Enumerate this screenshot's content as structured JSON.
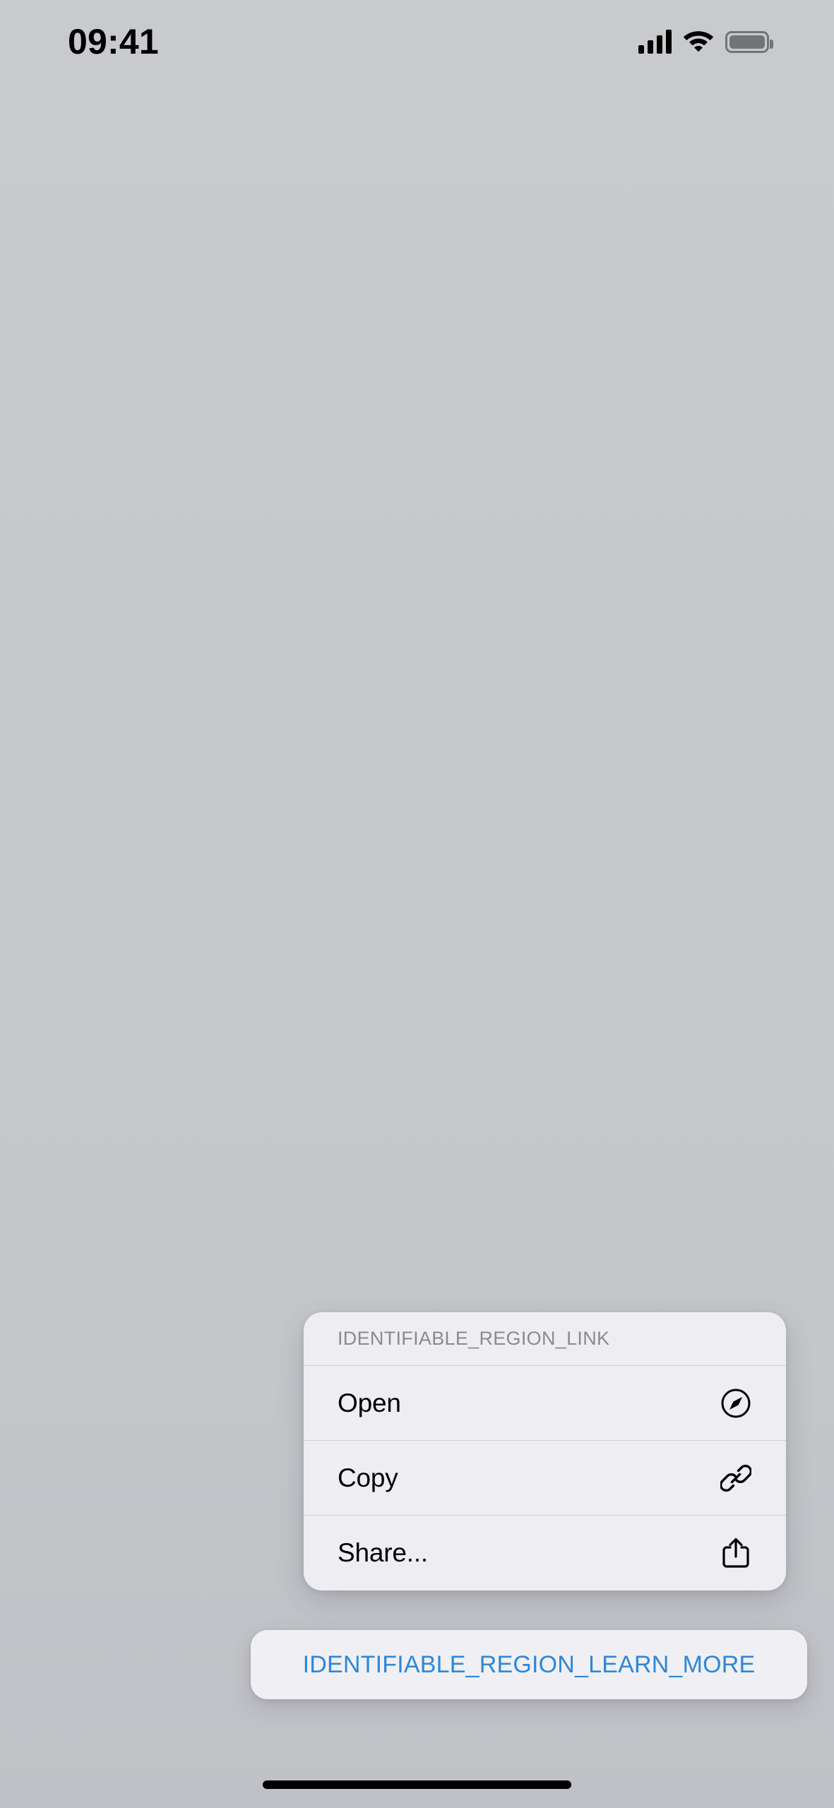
{
  "status_bar": {
    "time": "09:41",
    "icons": {
      "cellular": "cellular-signal-icon",
      "wifi": "wifi-icon",
      "battery": "battery-icon"
    },
    "signal_bars": 4,
    "battery_full": true
  },
  "context_menu": {
    "header_title": "IDENTIFIABLE_REGION_LINK",
    "items": [
      {
        "label": "Open",
        "icon": "compass-icon"
      },
      {
        "label": "Copy",
        "icon": "link-icon"
      },
      {
        "label": "Share...",
        "icon": "share-icon"
      }
    ]
  },
  "learn_more_button": {
    "label": "IDENTIFIABLE_REGION_LEARN_MORE"
  },
  "home_indicator": {
    "name": "home-indicator"
  },
  "colors": {
    "background": "#c6c8cc",
    "card": "#f0f0f4",
    "link_blue": "#2f87d8",
    "header_text": "#8a8a90",
    "primary_text": "#000000",
    "separator": "rgba(60,60,67,0.17)"
  }
}
